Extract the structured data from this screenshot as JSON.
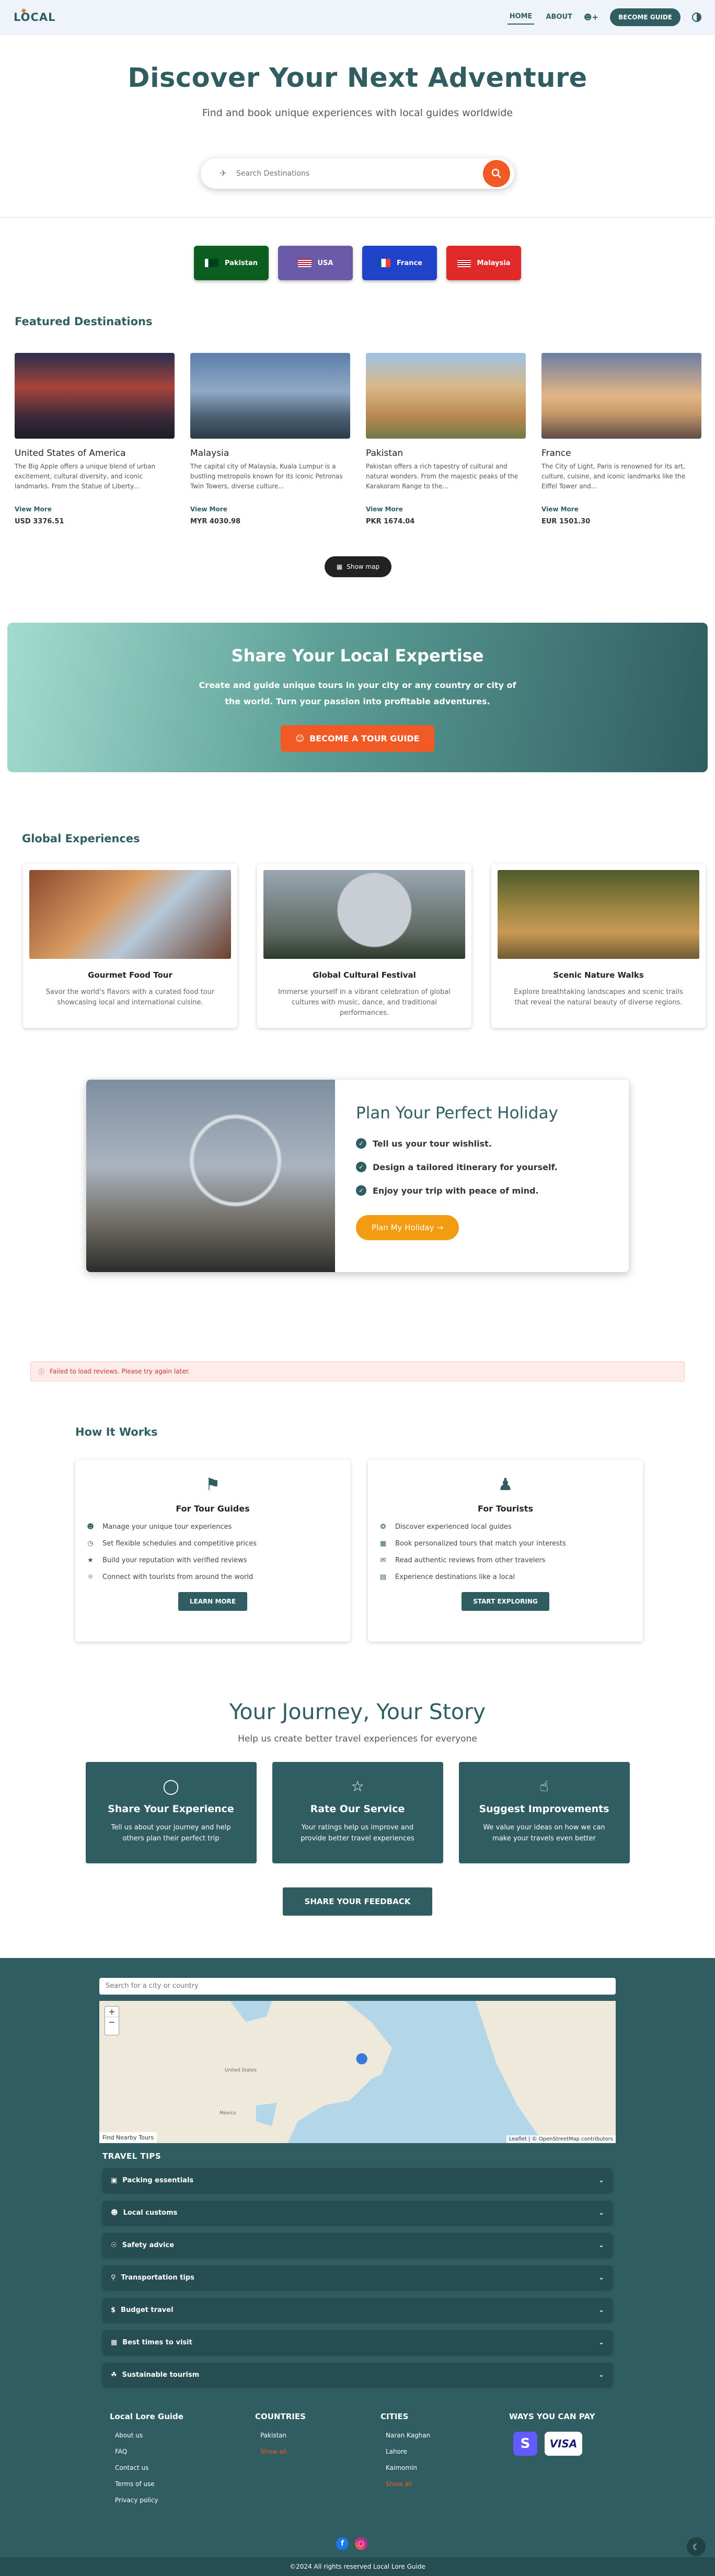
{
  "header": {
    "logo": "LOCAL",
    "nav": {
      "home": "HOME",
      "about": "ABOUT",
      "become": "BECOME GUIDE"
    }
  },
  "hero": {
    "title": "Discover Your Next Adventure",
    "subtitle": "Find and book unique experiences with local guides worldwide",
    "search_placeholder": "Search Destinations"
  },
  "countries": [
    {
      "label": "Pakistan",
      "color": "#0b5e1f"
    },
    {
      "label": "USA",
      "color": "#6a5aa8"
    },
    {
      "label": "France",
      "color": "#2143c9"
    },
    {
      "label": "Malaysia",
      "color": "#e02a2a"
    }
  ],
  "featured": {
    "title": "Featured Destinations",
    "view_more": "View More",
    "cards": [
      {
        "name": "United States of America",
        "desc": "The Big Apple offers a unique blend of urban excitement, cultural diversity, and iconic landmarks. From the Statue of Liberty...",
        "price": "USD 3376.51"
      },
      {
        "name": "Malaysia",
        "desc": "The capital city of Malaysia, Kuala Lumpur is a bustling metropolis known for its iconic Petronas Twin Towers, diverse culture...",
        "price": "MYR 4030.98"
      },
      {
        "name": "Pakistan",
        "desc": "Pakistan offers a rich tapestry of cultural and natural wonders. From the majestic peaks of the Karakoram Range to the...",
        "price": "PKR 1674.04"
      },
      {
        "name": "France",
        "desc": "The City of Light, Paris is renowned for its art, culture, cuisine, and iconic landmarks like the Eiffel Tower and...",
        "price": "EUR 1501.30"
      }
    ],
    "show_map": "Show map"
  },
  "banner": {
    "title": "Share Your Local Expertise",
    "text": "Create and guide unique tours in your city or any country or city of the world. Turn your passion into profitable adventures.",
    "cta": "BECOME A TOUR GUIDE"
  },
  "global": {
    "title": "Global Experiences",
    "cards": [
      {
        "title": "Gourmet Food Tour",
        "text": "Savor the world's flavors with a curated food tour showcasing local and international cuisine."
      },
      {
        "title": "Global Cultural Festival",
        "text": "Immerse yourself in a vibrant celebration of global cultures with music, dance, and traditional performances."
      },
      {
        "title": "Scenic Nature Walks",
        "text": "Explore breathtaking landscapes and scenic trails that reveal the natural beauty of diverse regions."
      }
    ]
  },
  "holiday": {
    "title": "Plan Your Perfect Holiday",
    "items": [
      "Tell us your tour wishlist.",
      "Design a tailored itinerary for yourself.",
      "Enjoy your trip with peace of mind."
    ],
    "cta": "Plan My Holiday →"
  },
  "error": "Failed to load reviews. Please try again later.",
  "how": {
    "title": "How It Works",
    "guides": {
      "title": "For Tour Guides",
      "items": [
        "Manage your unique tour experiences",
        "Set flexible schedules and competitive prices",
        "Build your reputation with verified reviews",
        "Connect with tourists from around the world"
      ],
      "btn": "LEARN MORE"
    },
    "tourists": {
      "title": "For Tourists",
      "items": [
        "Discover experienced local guides",
        "Book personalized tours that match your interests",
        "Read authentic reviews from other travelers",
        "Experience destinations like a local"
      ],
      "btn": "START EXPLORING"
    }
  },
  "journey": {
    "title": "Your Journey, Your Story",
    "subtitle": "Help us create better travel experiences for everyone",
    "cards": [
      {
        "title": "Share Your Experience",
        "text": "Tell us about your journey and help others plan their perfect trip"
      },
      {
        "title": "Rate Our Service",
        "text": "Your ratings help us improve and provide better travel experiences"
      },
      {
        "title": "Suggest Improvements",
        "text": "We value your ideas on how we can make your travels even better"
      }
    ],
    "btn": "SHARE YOUR FEEDBACK"
  },
  "footer": {
    "map_search": "Search for a city or country",
    "nearby": "Find Nearby Tours",
    "attribution": "Leaflet | © OpenStreetMap contributors",
    "map_labels": {
      "us": "United States",
      "mexico": "México"
    },
    "tips_title": "TRAVEL TIPS",
    "tips": [
      "Packing essentials",
      "Local customs",
      "Safety advice",
      "Transportation tips",
      "Budget travel",
      "Best times to visit",
      "Sustainable tourism"
    ],
    "cols": [
      {
        "title": "Local Lore Guide",
        "items": [
          "About us",
          "FAQ",
          "Contact us",
          "Terms of use",
          "Privacy policy"
        ]
      },
      {
        "title": "COUNTRIES",
        "items": [
          "Pakistan",
          "Show all"
        ]
      },
      {
        "title": "CITIES",
        "items": [
          "Naran Kaghan",
          "Lahore",
          "Kaimomin",
          "Show all"
        ]
      },
      {
        "title": "WAYS YOU CAN PAY",
        "items": []
      }
    ],
    "pay": {
      "stripe": "S",
      "visa": "VISA"
    },
    "copyright": "©2024 All rights reserved Local Lore Guide"
  }
}
